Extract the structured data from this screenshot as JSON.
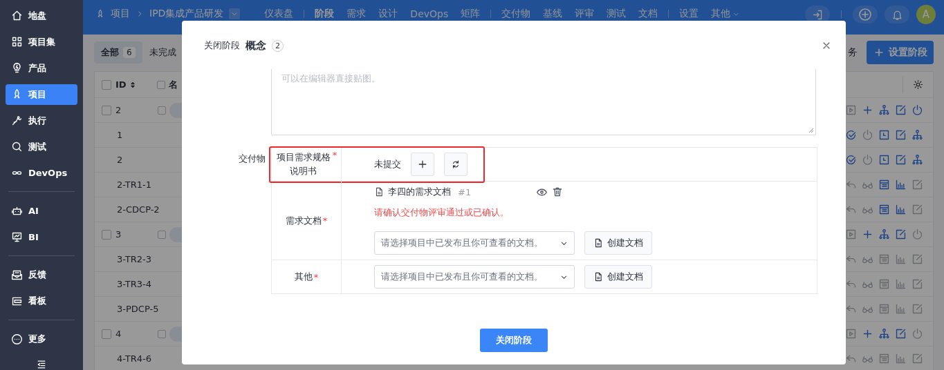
{
  "sidebar": {
    "groups": [
      [
        {
          "label": "地盘",
          "selected": false
        },
        {
          "label": "项目集",
          "selected": false
        },
        {
          "label": "产品",
          "selected": false
        },
        {
          "label": "项目",
          "selected": true
        },
        {
          "label": "执行",
          "selected": false
        },
        {
          "label": "测试",
          "selected": false
        },
        {
          "label": "DevOps",
          "selected": false
        }
      ],
      [
        {
          "label": "AI",
          "selected": false
        },
        {
          "label": "BI",
          "selected": false
        }
      ],
      [
        {
          "label": "反馈",
          "selected": false
        },
        {
          "label": "看板",
          "selected": false
        }
      ],
      [
        {
          "label": "更多",
          "selected": false
        }
      ]
    ]
  },
  "topbar": {
    "section": "项目",
    "project": "IPD集成产品研发",
    "nav": [
      [
        {
          "label": "仪表盘",
          "selected": false
        }
      ],
      [
        {
          "label": "阶段",
          "selected": true
        },
        {
          "label": "需求",
          "selected": false
        },
        {
          "label": "设计",
          "selected": false
        },
        {
          "label": "DevOps",
          "selected": false
        },
        {
          "label": "矩阵",
          "selected": false
        }
      ],
      [
        {
          "label": "交付物",
          "selected": false
        },
        {
          "label": "基线",
          "selected": false
        },
        {
          "label": "评审",
          "selected": false
        },
        {
          "label": "测试",
          "selected": false
        },
        {
          "label": "文档",
          "selected": false
        }
      ],
      [
        {
          "label": "设置",
          "selected": false
        },
        {
          "label": "其他",
          "selected": false,
          "dropdown": true
        }
      ]
    ],
    "avatar": "A"
  },
  "page": {
    "filters": [
      {
        "label": "全部",
        "count": "6",
        "selected": true
      },
      {
        "label": "未完成",
        "selected": false
      }
    ],
    "side_text": "务",
    "action_button": "设置阶段",
    "table": {
      "columns": [
        "ID",
        "名"
      ],
      "all_checked": false,
      "rows": [
        {
          "id": "2",
          "kind": "group",
          "enabled": true,
          "checked": false
        },
        {
          "id": "1",
          "kind": "task"
        },
        {
          "id": "2",
          "kind": "task"
        },
        {
          "id": "2-TR1-1",
          "kind": "review",
          "enabled": true
        },
        {
          "id": "2-CDCP-2",
          "kind": "review",
          "enabled": true
        },
        {
          "id": "3",
          "kind": "group",
          "enabled": false,
          "checked": false
        },
        {
          "id": "3-TR2-3",
          "kind": "review",
          "enabled": false
        },
        {
          "id": "3-TR3-4",
          "kind": "review",
          "enabled": false
        },
        {
          "id": "3-PDCP-5",
          "kind": "review",
          "enabled": false
        },
        {
          "id": "4",
          "kind": "group",
          "enabled": false,
          "checked": false
        },
        {
          "id": "4-TR4-6",
          "kind": "review",
          "enabled": false
        }
      ]
    }
  },
  "modal": {
    "title": "关闭阶段",
    "stage": "概念",
    "count": "2",
    "editor_placeholder": "可以在编辑器直接贴图。",
    "deliverables_label": "交付物",
    "deliverables": [
      {
        "kind": "pending",
        "name": "项目需求规格说明书",
        "required_mark": "*",
        "highlighted": true,
        "status": "未提交"
      },
      {
        "kind": "document",
        "name": "需求文档",
        "required_mark": "*",
        "highlighted": false,
        "files": [
          {
            "name": "李四的需求文档",
            "version": "#1"
          }
        ],
        "error": "请确认交付物评审通过或已确认。",
        "placeholder": "请选择项目中已发布且你可查看的文档。",
        "create_label": "创建文档"
      },
      {
        "kind": "document",
        "name": "其他",
        "required_mark": "*",
        "highlighted": false,
        "placeholder": "请选择项目中已发布且你可查看的文档。",
        "create_label": "创建文档"
      }
    ],
    "submit": "关闭阶段"
  }
}
